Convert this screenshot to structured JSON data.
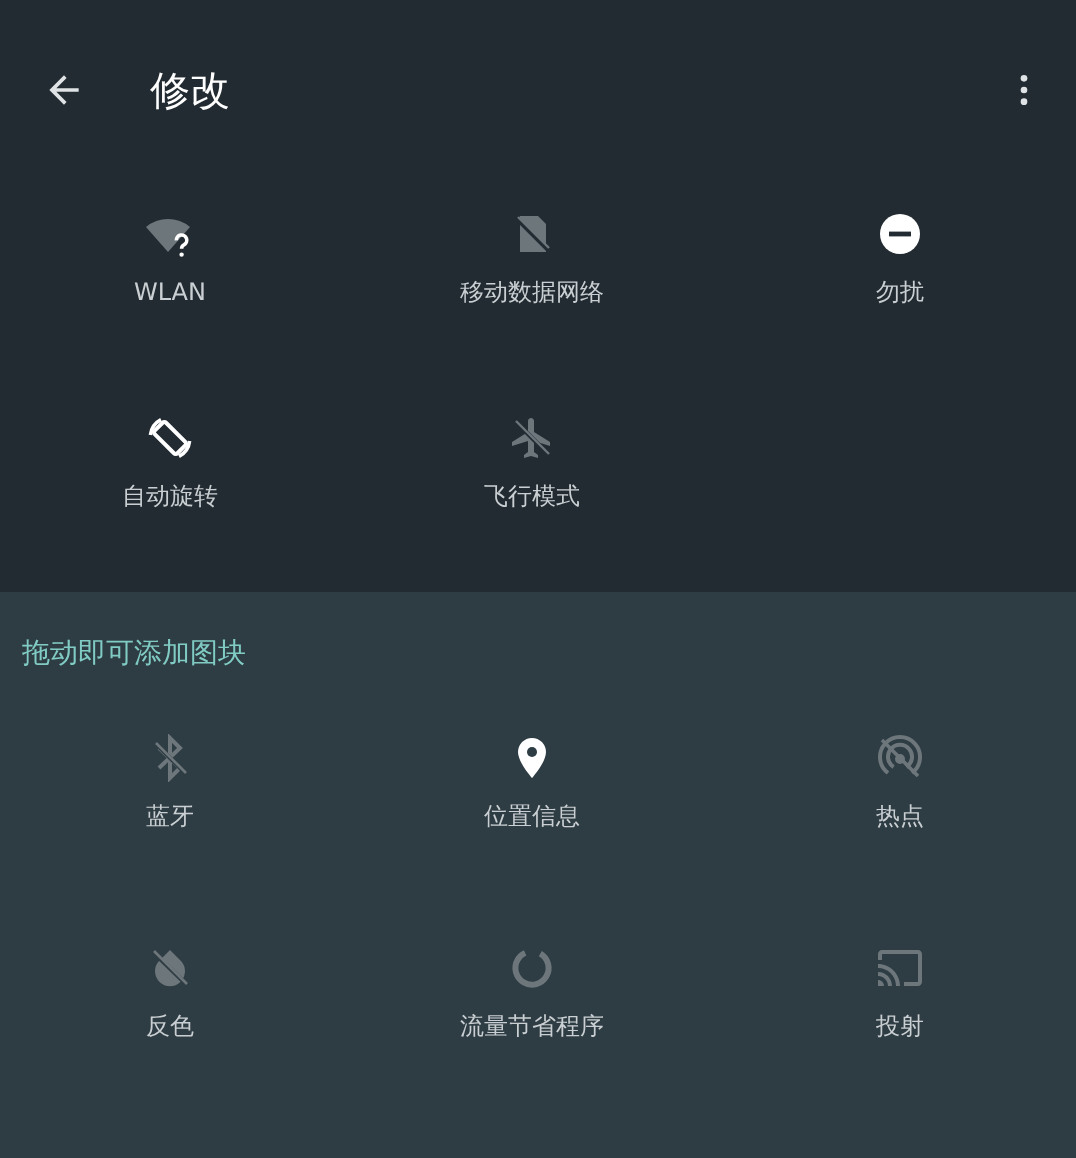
{
  "toolbar": {
    "title": "修改"
  },
  "active_tiles": [
    {
      "label": "WLAN",
      "kind": "wifi",
      "on": false
    },
    {
      "label": "移动数据网络",
      "kind": "mobile-data",
      "on": false
    },
    {
      "label": "勿扰",
      "kind": "dnd",
      "on": true
    },
    {
      "label": "自动旋转",
      "kind": "rotate",
      "on": true
    },
    {
      "label": "飞行模式",
      "kind": "airplane",
      "on": false
    }
  ],
  "available_section": {
    "heading": "拖动即可添加图块",
    "tiles": [
      {
        "label": "蓝牙",
        "kind": "bluetooth",
        "on": false
      },
      {
        "label": "位置信息",
        "kind": "location",
        "on": true
      },
      {
        "label": "热点",
        "kind": "hotspot",
        "on": false
      },
      {
        "label": "反色",
        "kind": "invert",
        "on": false
      },
      {
        "label": "流量节省程序",
        "kind": "data-saver",
        "on": false
      },
      {
        "label": "投射",
        "kind": "cast",
        "on": false
      }
    ]
  }
}
